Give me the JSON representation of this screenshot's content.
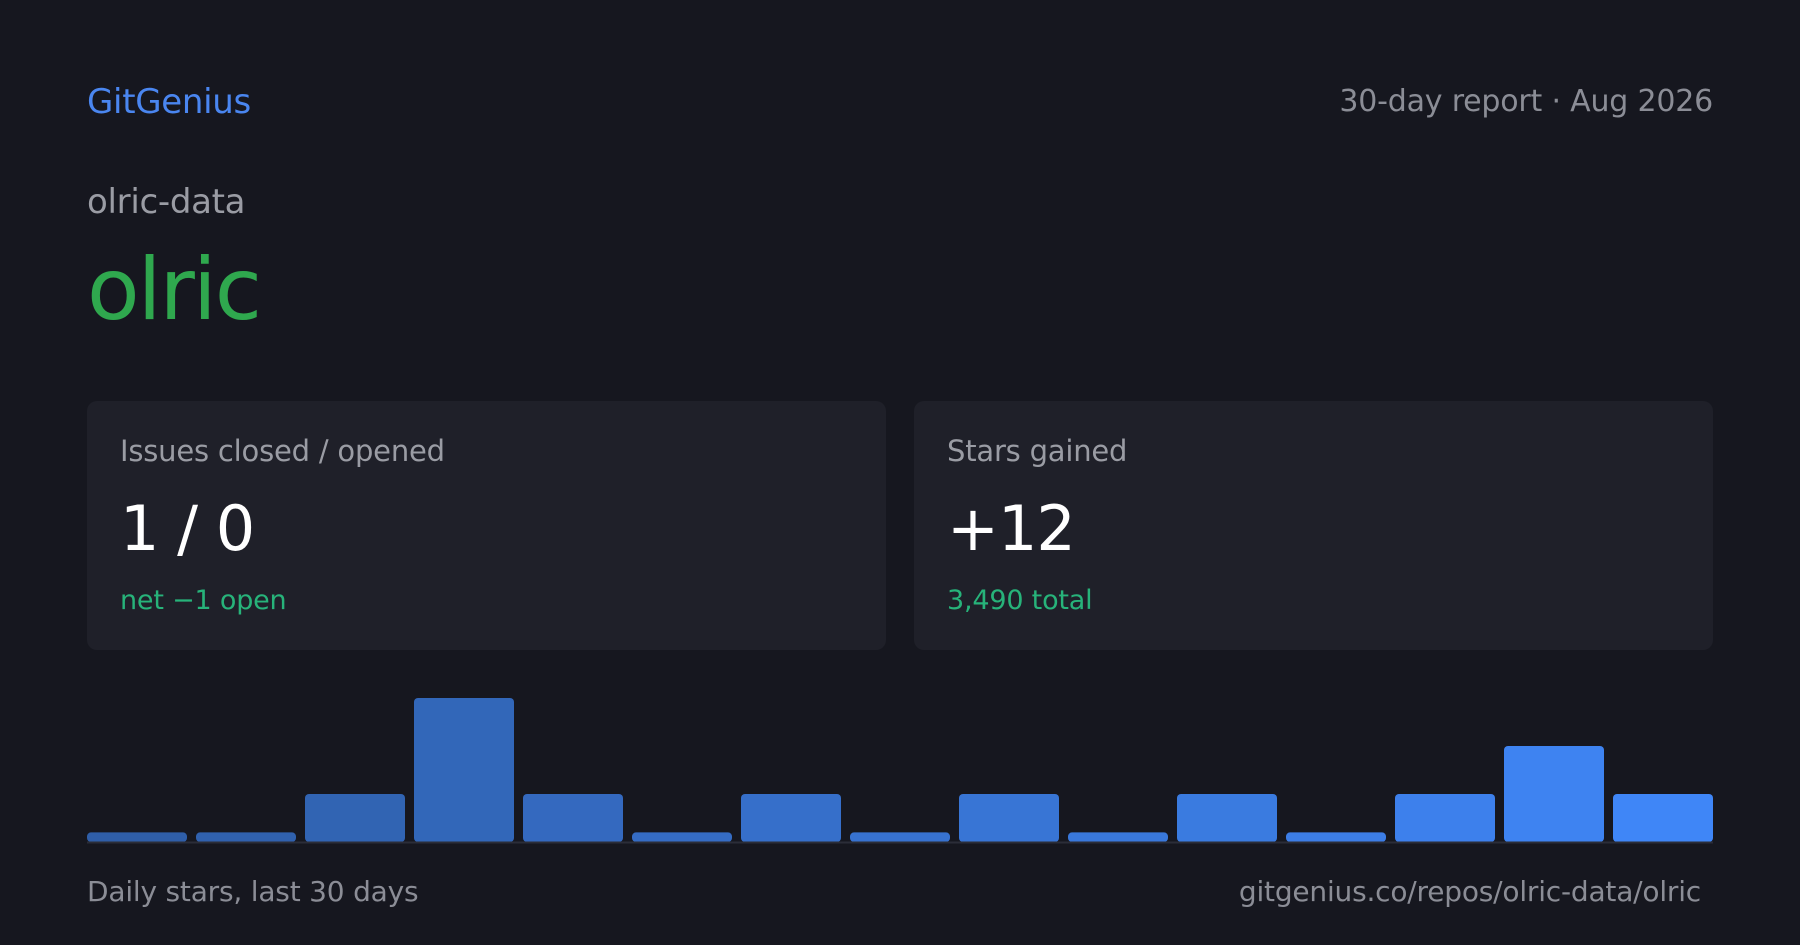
{
  "header": {
    "brand": "GitGenius",
    "report_label": "30-day report · Aug 2026"
  },
  "repo": {
    "owner": "olric-data",
    "name": "olric"
  },
  "cards": {
    "issues": {
      "label": "Issues closed / opened",
      "value": "1 / 0",
      "sub": "net −1 open"
    },
    "stars": {
      "label": "Stars gained",
      "value": "+12",
      "sub": "3,490 total"
    }
  },
  "colors": {
    "background": "#16171f",
    "card": "#1f2029",
    "brand": "#4a86f0",
    "repo_name": "#2fa84e",
    "positive": "#27b37a",
    "bar_start": "#2f5ea8",
    "bar_end": "#3f86f7"
  },
  "chart_data": {
    "type": "bar",
    "values": [
      0.1,
      0.1,
      0.5,
      1.5,
      0.5,
      0.1,
      0.5,
      0.1,
      0.5,
      0.1,
      0.5,
      0.1,
      0.5,
      1,
      0.5
    ],
    "ylim": [
      0,
      1.5
    ]
  },
  "footer": {
    "chart_caption": "Daily stars, last 30 days",
    "url": "gitgenius.co/repos/olric-data/olric"
  }
}
